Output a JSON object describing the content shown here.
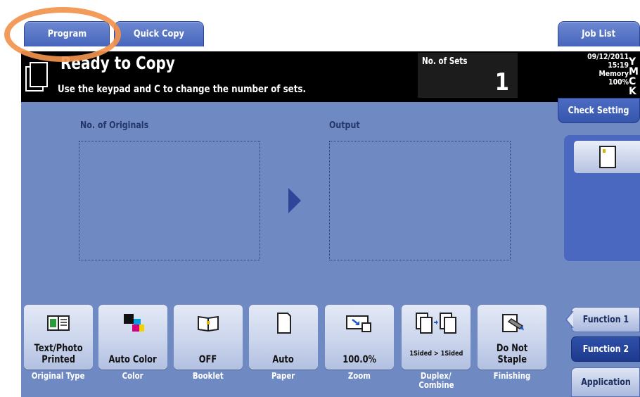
{
  "top_tabs": {
    "program": "Program",
    "quick_copy": "Quick Copy",
    "job_list": "Job List"
  },
  "status": {
    "title": "Ready to Copy",
    "message": "Use the keypad and C to change the number of sets.",
    "sets_label": "No. of Sets",
    "sets_value": "1",
    "date": "09/12/2011",
    "time": "15:19",
    "memory_label": "Memory",
    "memory_value": "100%",
    "toner": [
      {
        "letter": "Y",
        "color": "#f4d000"
      },
      {
        "letter": "M",
        "color": "#d6007d"
      },
      {
        "letter": "C",
        "color": "#00a0e0"
      },
      {
        "letter": "K",
        "color": "#333333"
      }
    ]
  },
  "main": {
    "originals_label": "No. of Originals",
    "output_label": "Output"
  },
  "right_panel": {
    "check_setting": "Check Setting",
    "function_tabs": [
      "Function 1",
      "Function 2",
      "Application"
    ]
  },
  "functions": [
    {
      "value": [
        "Text/Photo",
        "Printed"
      ],
      "label": [
        "Original Type"
      ],
      "icon": "original-type-icon"
    },
    {
      "value": [
        "Auto Color"
      ],
      "label": [
        "Color"
      ],
      "icon": "color-icon"
    },
    {
      "value": [
        "OFF"
      ],
      "label": [
        "Booklet"
      ],
      "icon": "booklet-icon"
    },
    {
      "value": [
        "Auto"
      ],
      "label": [
        "Paper"
      ],
      "icon": "paper-icon"
    },
    {
      "value": [
        "100.0%"
      ],
      "label": [
        "Zoom"
      ],
      "icon": "zoom-icon"
    },
    {
      "value": [
        "1Sided > 1Sided"
      ],
      "label": [
        "Duplex/",
        "Combine"
      ],
      "icon": "duplex-icon"
    },
    {
      "value": [
        "Do Not",
        "Staple"
      ],
      "label": [
        "Finishing"
      ],
      "icon": "finishing-icon"
    }
  ],
  "colors": {
    "panel_blue": "#6f89c3",
    "tab_blue": "#4766bc",
    "highlight_orange": "#f2924c"
  }
}
